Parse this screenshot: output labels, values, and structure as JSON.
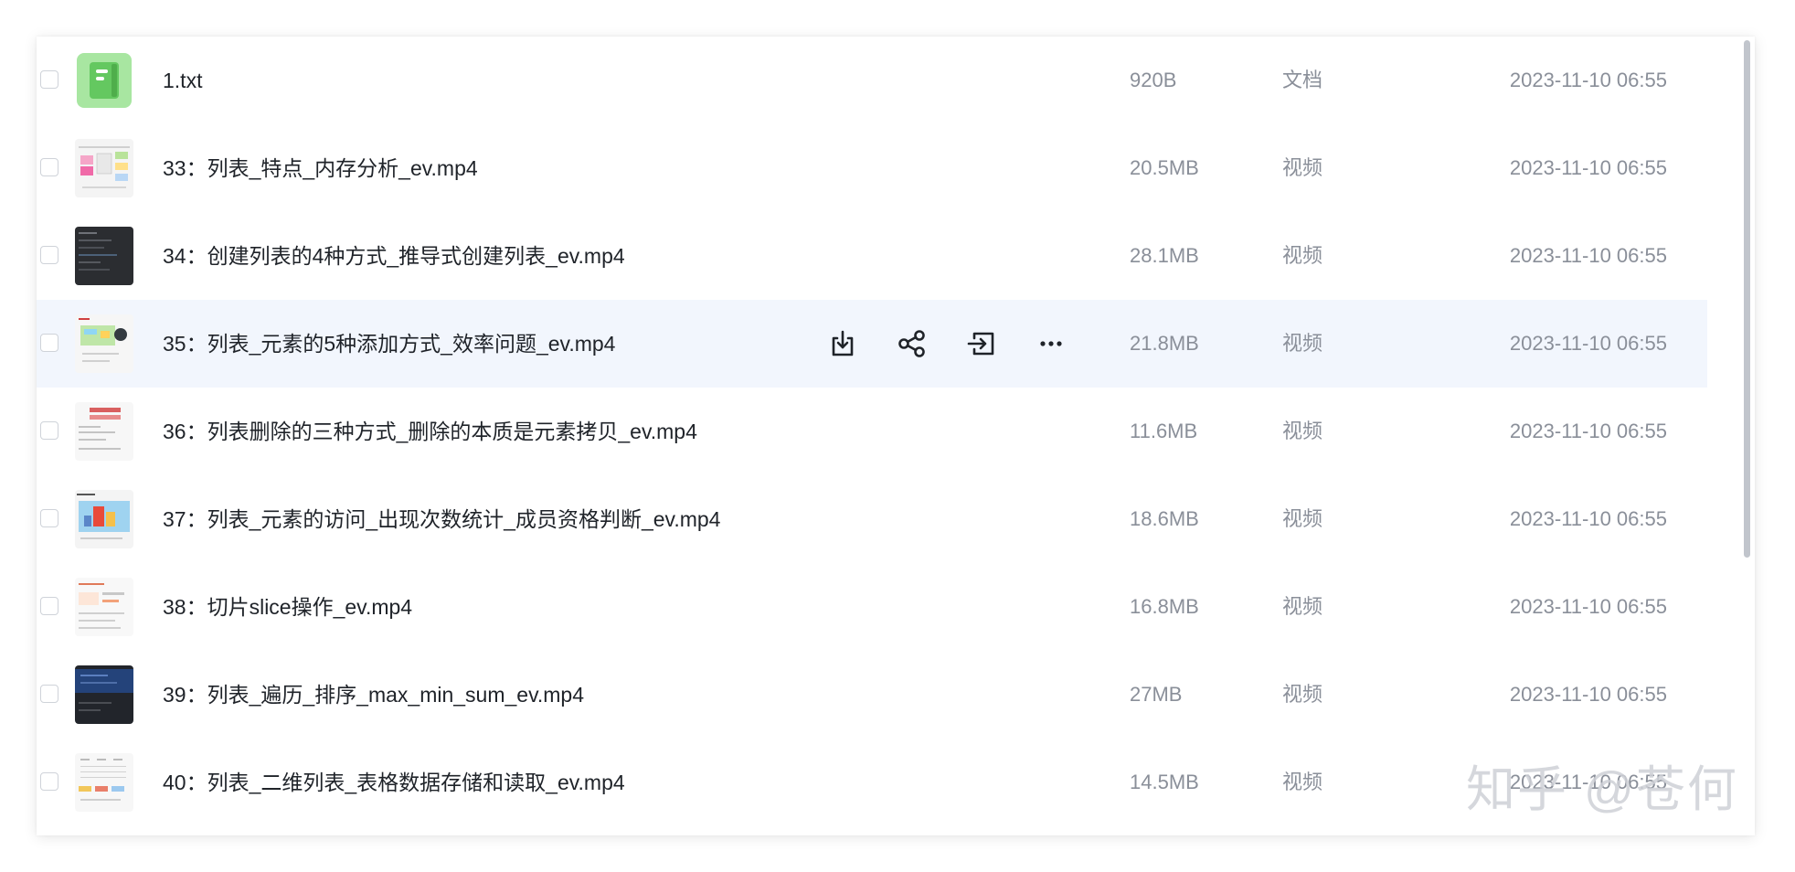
{
  "files": [
    {
      "name": "1.txt",
      "size": "920B",
      "type": "文档",
      "date": "2023-11-10 06:55",
      "thumb": "doc-icon"
    },
    {
      "name": "33：列表_特点_内存分析_ev.mp4",
      "size": "20.5MB",
      "type": "视频",
      "date": "2023-11-10 06:55",
      "thumb": "video-thumbnail"
    },
    {
      "name": "34：创建列表的4种方式_推导式创建列表_ev.mp4",
      "size": "28.1MB",
      "type": "视频",
      "date": "2023-11-10 06:55",
      "thumb": "video-thumbnail"
    },
    {
      "name": "35：列表_元素的5种添加方式_效率问题_ev.mp4",
      "size": "21.8MB",
      "type": "视频",
      "date": "2023-11-10 06:55",
      "thumb": "video-thumbnail"
    },
    {
      "name": "36：列表删除的三种方式_删除的本质是元素拷贝_ev.mp4",
      "size": "11.6MB",
      "type": "视频",
      "date": "2023-11-10 06:55",
      "thumb": "video-thumbnail"
    },
    {
      "name": "37：列表_元素的访问_出现次数统计_成员资格判断_ev.mp4",
      "size": "18.6MB",
      "type": "视频",
      "date": "2023-11-10 06:55",
      "thumb": "video-thumbnail"
    },
    {
      "name": "38：切片slice操作_ev.mp4",
      "size": "16.8MB",
      "type": "视频",
      "date": "2023-11-10 06:55",
      "thumb": "video-thumbnail"
    },
    {
      "name": "39：列表_遍历_排序_max_min_sum_ev.mp4",
      "size": "27MB",
      "type": "视频",
      "date": "2023-11-10 06:55",
      "thumb": "video-thumbnail"
    },
    {
      "name": "40：列表_二维列表_表格数据存储和读取_ev.mp4",
      "size": "14.5MB",
      "type": "视频",
      "date": "2023-11-10 06:55",
      "thumb": "video-thumbnail"
    }
  ],
  "hovered_row_actions": [
    "download-icon",
    "share-icon",
    "move-to-icon",
    "more-options-icon"
  ],
  "watermark": "知乎 @苍何",
  "colors": {
    "hover_row": "#f2f6fd",
    "text_primary": "#1f2329",
    "text_secondary": "#8a8f99",
    "doc_icon": "#64c860"
  }
}
